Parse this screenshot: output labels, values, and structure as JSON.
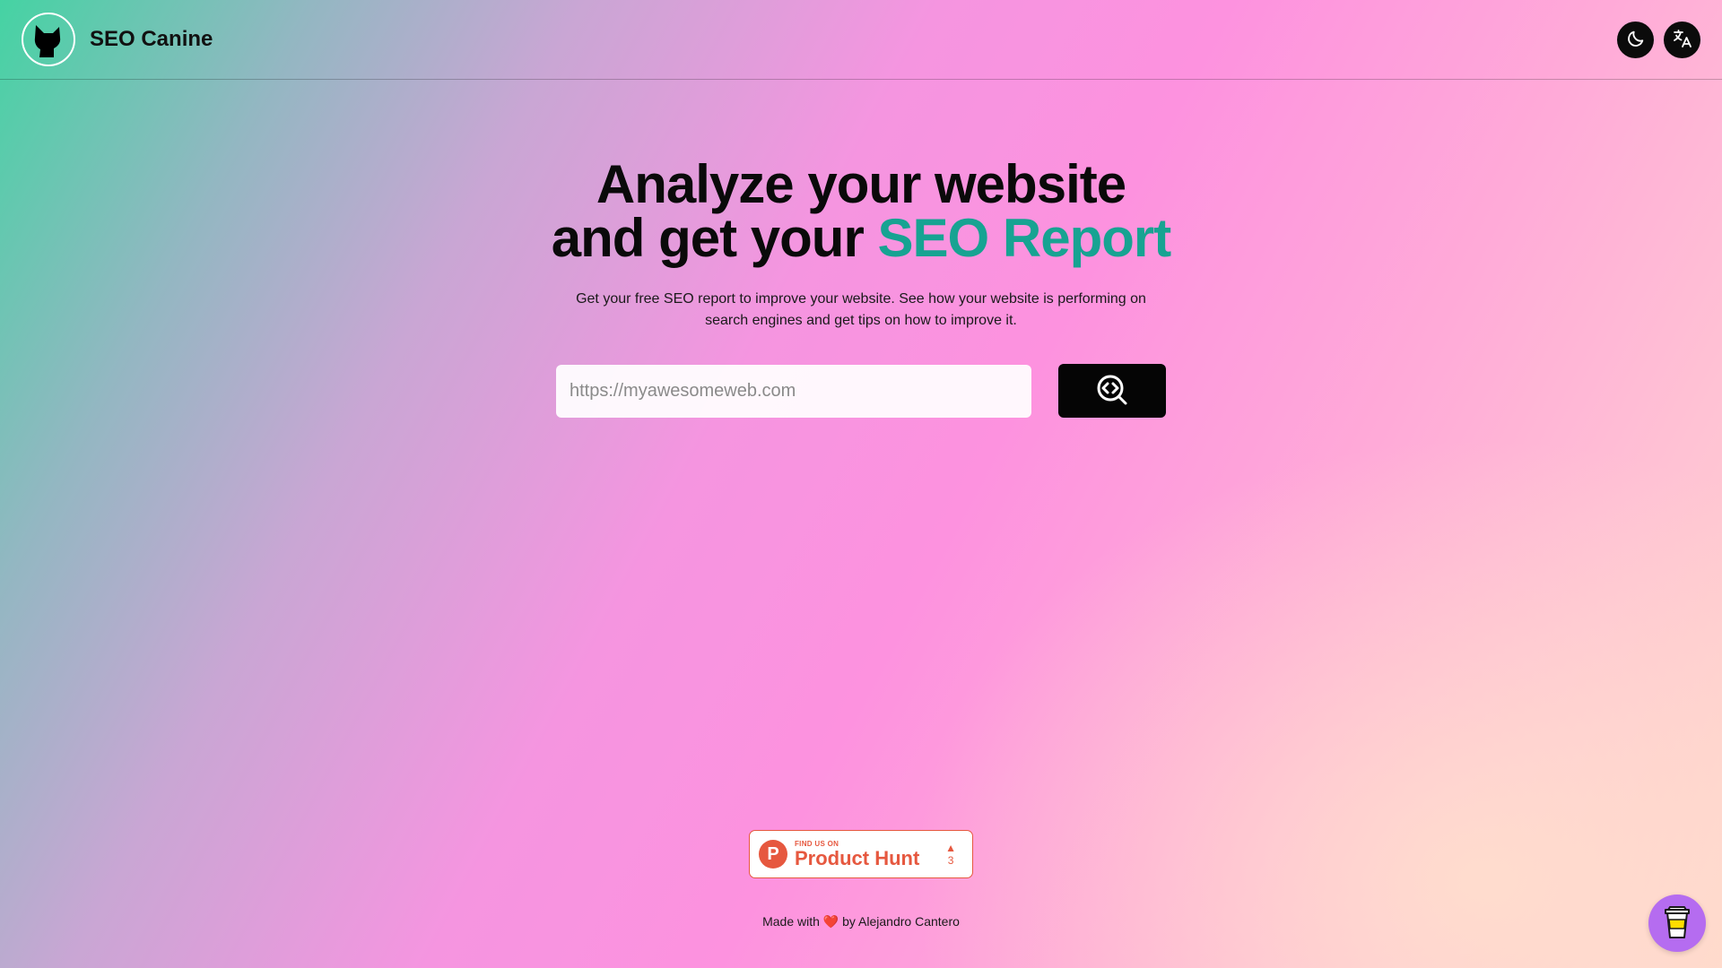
{
  "header": {
    "brand_name": "SEO Canine",
    "logo_icon": "dog-head-icon",
    "theme_toggle_icon": "moon-icon",
    "language_icon": "translate-icon"
  },
  "hero": {
    "title_line1": "Analyze your website",
    "title_line2_prefix": "and get your ",
    "title_line2_accent": "SEO Report",
    "subtitle": "Get your free SEO report to improve your website. See how your website is performing on search engines and get tips on how to improve it."
  },
  "search": {
    "value": "",
    "placeholder": "https://myawesomeweb.com",
    "button_icon": "code-search-icon"
  },
  "product_hunt": {
    "small_text": "FIND US ON",
    "big_text": "Product Hunt",
    "logo_letter": "P",
    "arrow": "▲",
    "votes": "3"
  },
  "footer": {
    "prefix": "Made with ",
    "heart": "❤️",
    "suffix": " by Alejandro Cantero"
  },
  "floating": {
    "coffee_icon": "coffee-cup-icon"
  },
  "colors": {
    "accent": "#17a392",
    "product_hunt": "#e6583f",
    "coffee_button": "#b56cf0"
  }
}
